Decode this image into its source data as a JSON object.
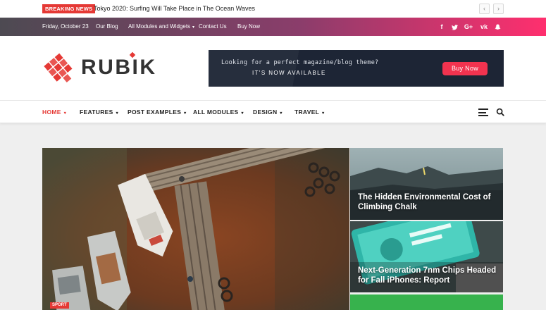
{
  "breaking": {
    "badge": "BREAKING NEWS",
    "headline": "Tokyo 2020: Surfing Will Take Place in The Ocean Waves",
    "prev_icon": "chevron-left",
    "next_icon": "chevron-right"
  },
  "topbar": {
    "date": "Friday, October 23",
    "links": [
      "Our Blog",
      "All Modules and Widgets",
      "Contact Us",
      "Buy Now"
    ],
    "social": [
      "f",
      "t",
      "G+",
      "vk",
      "snapchat"
    ]
  },
  "logo": {
    "text": "RUBIK"
  },
  "ad": {
    "line1": "Looking for a perfect magazine/blog theme?",
    "line2": "IT'S NOW AVAILABLE",
    "button": "Buy Now"
  },
  "main_nav": {
    "items": [
      "HOME",
      "FEATURES",
      "POST EXAMPLES",
      "ALL MODULES",
      "DESIGN",
      "TRAVEL"
    ]
  },
  "feature": {
    "category": "SPORT"
  },
  "side_posts": [
    {
      "title": "The Hidden Environmental Cost of Climbing Chalk"
    },
    {
      "title": "Next-Generation 7nm Chips Headed for Fall iPhones: Report"
    }
  ],
  "colors": {
    "accent": "#e53935",
    "gradient_start": "#4d4a52",
    "gradient_end": "#ff2f6e"
  }
}
